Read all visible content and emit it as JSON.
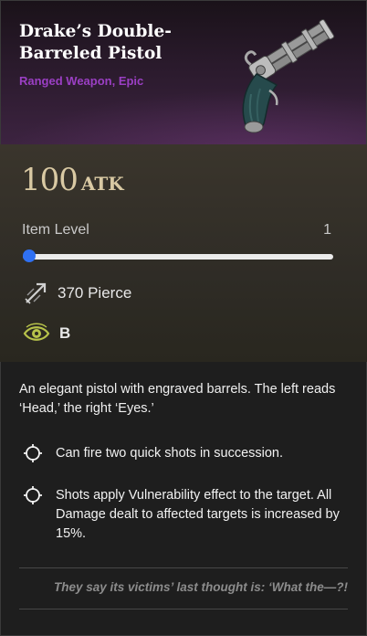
{
  "item": {
    "name": "Drake’s Double-\nBarreled Pistol",
    "type_rarity": "Ranged Weapon, Epic",
    "icon": "flintlock-pistol-icon"
  },
  "stats": {
    "atk_value": "100",
    "atk_unit": "ATK",
    "item_level_label": "Item Level",
    "item_level_value": "1",
    "level_slider_fraction": 0.0,
    "pierce_text": "370 Pierce",
    "pierce_icon": "pierce-arrow-icon",
    "perception_text": "B",
    "perception_icon": "eye-icon"
  },
  "description": "An elegant pistol with engraved barrels. The left reads ‘Head,’ the right ‘Eyes.’",
  "perks": [
    {
      "icon": "crosshair-icon",
      "text": "Can fire two quick shots in succession."
    },
    {
      "icon": "crosshair-icon",
      "text": "Shots apply Vulnerability effect to the target. All Damage dealt to affected targets is increased by 15%."
    }
  ],
  "flavor_text": "They say its victims’ last thought is: ‘What the—?!",
  "colors": {
    "rarity": "#9b3fc4",
    "atk": "#d9c9a3",
    "slider": "#2d6ef0",
    "eye_icon": "#b7c24a"
  }
}
